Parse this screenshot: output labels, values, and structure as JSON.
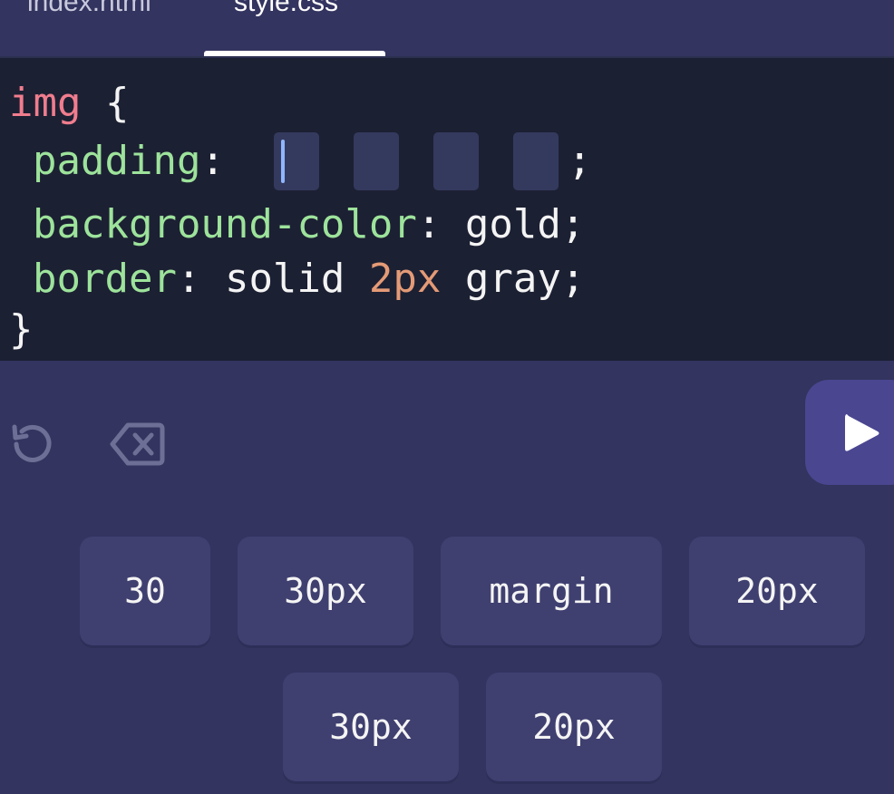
{
  "tabs": [
    {
      "label": "index.html",
      "active": false
    },
    {
      "label": "style.css",
      "active": true
    }
  ],
  "code": {
    "line1": {
      "selector": "img",
      "brace": "{"
    },
    "line2": {
      "property": "padding",
      "colon": ":",
      "slot_count": 4,
      "terminator": ";"
    },
    "line3": {
      "property": "background-color",
      "colon": ":",
      "value": "gold;"
    },
    "line4": {
      "property": "border",
      "colon": ":",
      "value1": "solid",
      "value2": "2px",
      "value3": "gray;"
    },
    "line5": {
      "brace": "}"
    }
  },
  "controls": {
    "reset_icon": "reset-icon",
    "delete_icon": "backspace-icon",
    "run_icon": "play-icon"
  },
  "choices": [
    "30",
    "30px",
    "margin",
    "20px",
    "30px",
    "20px"
  ],
  "colors": {
    "background": "#33345f",
    "editor": "#1c2033",
    "selector": "#f07d8e",
    "property": "#9de39b",
    "number": "#e49a76",
    "chip": "#3f3f70",
    "run_button": "#4a4690"
  }
}
